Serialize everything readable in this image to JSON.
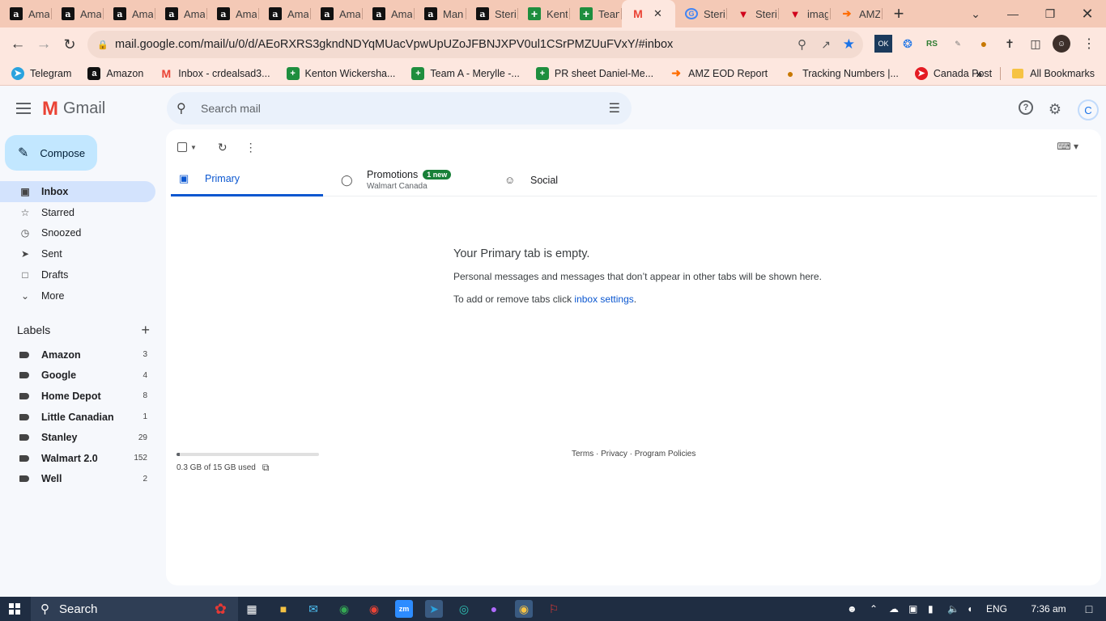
{
  "browser": {
    "tabs": [
      {
        "label": "Ama",
        "icon": "amazon-favicon"
      },
      {
        "label": "Ama",
        "icon": "amazon-favicon"
      },
      {
        "label": "Ama",
        "icon": "amazon-favicon"
      },
      {
        "label": "Ama",
        "icon": "amazon-favicon"
      },
      {
        "label": "Ama",
        "icon": "amazon-favicon"
      },
      {
        "label": "Ama",
        "icon": "amazon-favicon"
      },
      {
        "label": "Ama",
        "icon": "amazon-favicon"
      },
      {
        "label": "Ama",
        "icon": "amazon-favicon"
      },
      {
        "label": "Man",
        "icon": "amazon-favicon"
      },
      {
        "label": "Steri",
        "icon": "amazon-smile-favicon"
      },
      {
        "label": "Kent",
        "icon": "sheets-favicon"
      },
      {
        "label": "Tean",
        "icon": "sheets-favicon"
      },
      {
        "label": "",
        "icon": "gmail-favicon",
        "active": true
      },
      {
        "label": "Steri",
        "icon": "google-favicon"
      },
      {
        "label": "Steri",
        "icon": "red-favicon"
      },
      {
        "label": "imag",
        "icon": "red-favicon"
      },
      {
        "label": "AMZ",
        "icon": "amz-favicon"
      }
    ],
    "url": "mail.google.com/mail/u/0/d/AEoRXRS3gkndNDYqMUacVpwUpUZoJFBNJXPV0ul1CSrPMZUuFVxY/#inbox",
    "bookmarks": [
      {
        "label": "Telegram"
      },
      {
        "label": "Amazon"
      },
      {
        "label": "Inbox - crdealsad3..."
      },
      {
        "label": "Kenton Wickersha..."
      },
      {
        "label": "Team A - Merylle -..."
      },
      {
        "label": "PR sheet Daniel-Me..."
      },
      {
        "label": "AMZ EOD Report"
      },
      {
        "label": "Tracking Numbers |..."
      },
      {
        "label": "Canada Post"
      }
    ],
    "all_bookmarks": "All Bookmarks",
    "accent": "#f4c9b6"
  },
  "gmail": {
    "logo_text": "Gmail",
    "search_placeholder": "Search mail",
    "avatar_letter": "C",
    "compose": "Compose",
    "nav": [
      {
        "label": "Inbox",
        "icon": "inbox-icon",
        "active": true
      },
      {
        "label": "Starred",
        "icon": "star-icon"
      },
      {
        "label": "Snoozed",
        "icon": "clock-icon"
      },
      {
        "label": "Sent",
        "icon": "send-icon"
      },
      {
        "label": "Drafts",
        "icon": "draft-icon"
      },
      {
        "label": "More",
        "icon": "chevron-down-icon"
      }
    ],
    "labels_heading": "Labels",
    "labels": [
      {
        "label": "Amazon",
        "count": "3"
      },
      {
        "label": "Google",
        "count": "4"
      },
      {
        "label": "Home Depot",
        "count": "8"
      },
      {
        "label": "Little Canadian",
        "count": "1"
      },
      {
        "label": "Stanley",
        "count": "29"
      },
      {
        "label": "Walmart 2.0",
        "count": "152"
      },
      {
        "label": "Well",
        "count": "2"
      }
    ],
    "category_tabs": {
      "primary": "Primary",
      "promotions": "Promotions",
      "promotions_badge": "1 new",
      "promotions_sender": "Walmart Canada",
      "social": "Social"
    },
    "empty": {
      "title": "Your Primary tab is empty.",
      "line1": "Personal messages and messages that don’t appear in other tabs will be shown here.",
      "line2_prefix": "To add or remove tabs click ",
      "line2_link": "inbox settings",
      "line2_suffix": "."
    },
    "storage": {
      "text": "0.3 GB of 15 GB used",
      "used_fraction": 0.02
    },
    "footer": "Terms · Privacy · Program Policies",
    "accent": "#0b57d0"
  },
  "taskbar": {
    "search": "Search",
    "lang": "ENG",
    "time": "7:36 am"
  }
}
